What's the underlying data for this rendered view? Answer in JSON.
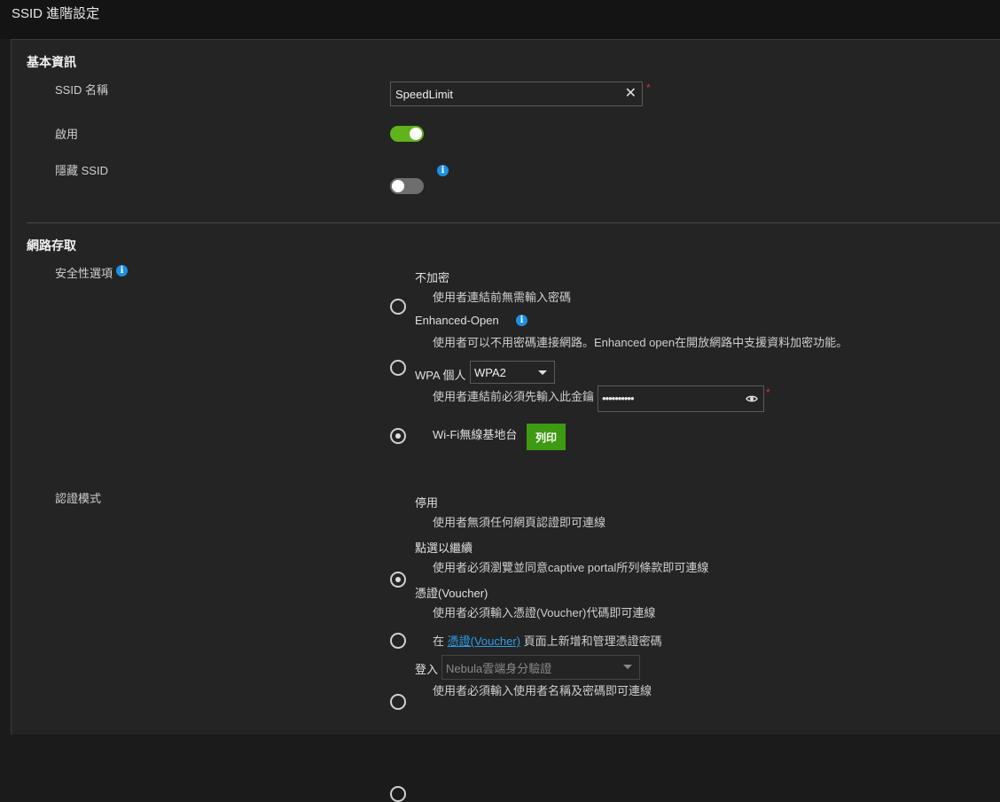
{
  "header": {
    "title": "SSID 進階設定"
  },
  "basic": {
    "title": "基本資訊",
    "ssid_name_label": "SSID 名稱",
    "ssid_name_value": "SpeedLimit",
    "required_mark": "*",
    "enable_label": "啟用",
    "enable_on": true,
    "hide_ssid_label": "隱藏 SSID",
    "hide_ssid_on": false
  },
  "network": {
    "title": "網路存取",
    "security_label": "安全性選項",
    "security_options": [
      {
        "label": "不加密",
        "desc": "使用者連結前無需輸入密碼",
        "checked": false
      },
      {
        "label": "Enhanced-Open",
        "desc": "使用者可以不用密碼連接網路。Enhanced open在開放網路中支援資料加密功能。",
        "checked": false
      },
      {
        "label": "WPA 個人",
        "desc": "使用者連結前必須先輸入此金鑰",
        "checked": true
      }
    ],
    "wpa_mode": "WPA2",
    "password_mask": "••••••••••",
    "wifi_station_label": "Wi-Fi無線基地台",
    "print_button": "列印"
  },
  "auth": {
    "label": "認證模式",
    "options": [
      {
        "label": "停用",
        "desc": "使用者無須任何網頁認證即可連線",
        "checked": true
      },
      {
        "label": "點選以繼續",
        "desc": "使用者必須瀏覽並同意captive portal所列條款即可連線",
        "checked": false
      },
      {
        "label": "憑證(Voucher)",
        "desc": "使用者必須輸入憑證(Voucher)代碼即可連線",
        "checked": false
      },
      {
        "label": "登入",
        "desc": "使用者必須輸入使用者名稱及密碼即可連線",
        "checked": false
      }
    ],
    "voucher_note_prefix": "在",
    "voucher_link": "憑證(Voucher)",
    "voucher_note_suffix": "頁面上新增和管理憑證密碼",
    "login_select": "Nebula雲端身分驗證"
  }
}
